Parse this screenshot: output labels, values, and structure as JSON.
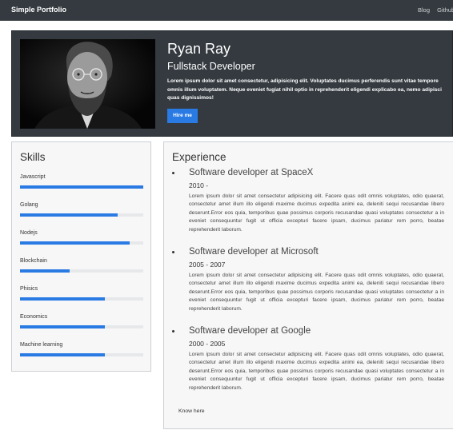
{
  "navbar": {
    "brand": "Simple Portfolio",
    "links": [
      "Blog",
      "Github"
    ]
  },
  "hero": {
    "name": "Ryan Ray",
    "role": "Fullstack Developer",
    "bio": "Lorem ipsum dolor sit amet consectetur, adipisicing elit. Voluptates ducimus perferendis sunt vitae tempore omnis illum voluptatem. Neque eveniet fugiat nihil optio in reprehenderit eligendi explicabo ea, nemo adipisci quas dignissimos!",
    "hire_label": "Hire me"
  },
  "skills": {
    "title": "Skills",
    "items": [
      {
        "label": "Javascript",
        "level": 1.0
      },
      {
        "label": "Golang",
        "level": 0.79
      },
      {
        "label": "Nodejs",
        "level": 0.89
      },
      {
        "label": "Blockchain",
        "level": 0.4
      },
      {
        "label": "Phisics",
        "level": 0.69
      },
      {
        "label": "Economics",
        "level": 0.69
      },
      {
        "label": "Machine learning",
        "level": 0.69
      }
    ],
    "accent": "#2a7ae4"
  },
  "experience": {
    "title": "Experience",
    "jobs": [
      {
        "title": "Software developer at SpaceX",
        "dates": "2010 -",
        "description": "Lorem ipsum dolor sit amet consectetur adipisicing elit. Facere quas odit omnis voluptates, odio quaerat, consectetur amet illum illo eligendi maxime ducimus expedita animi ea, deleniti sequi recusandae libero deserunt.Error eos quia, temporibus quae possimus corporis recusandae quasi voluptates consectetur a in eveniet consequuntur fugit ut officia excepturi facere ipsam, ducimus pariatur rem porro, beatae reprehenderit laborum."
      },
      {
        "title": "Software developer at Microsoft",
        "dates": "2005 - 2007",
        "description": "Lorem ipsum dolor sit amet consectetur adipisicing elit. Facere quas odit omnis voluptates, odio quaerat, consectetur amet illum illo eligendi maxime ducimus expedita animi ea, deleniti sequi recusandae libero deserunt.Error eos quia, temporibus quae possimus corporis recusandae quasi voluptates consectetur a in eveniet consequuntur fugit ut officia excepturi facere ipsam, ducimus pariatur rem porro, beatae reprehenderit laborum."
      },
      {
        "title": "Software developer at Google",
        "dates": "2000 - 2005",
        "description": "Lorem ipsum dolor sit amet consectetur adipisicing elit. Facere quas odit omnis voluptates, odio quaerat, consectetur amet illum illo eligendi maxime ducimus expedita animi ea, deleniti sequi recusandae libero deserunt.Error eos quia, temporibus quae possimus corporis recusandae quasi voluptates consectetur a in eveniet consequuntur fugit ut officia excepturi facere ipsam, ducimus pariatur rem porro, beatae reprehenderit laborum."
      }
    ],
    "know_here": "Know here"
  }
}
